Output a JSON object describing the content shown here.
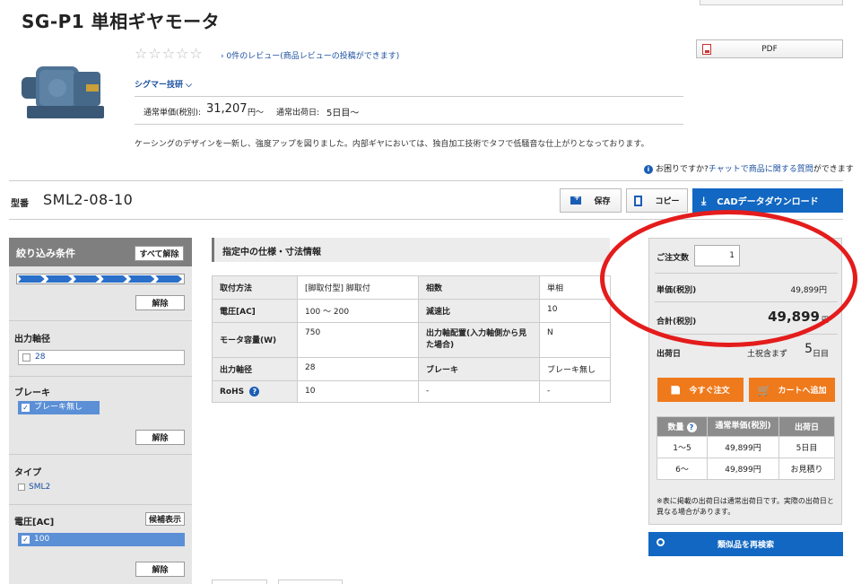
{
  "product": {
    "title": "SG-P1 単相ギヤモータ",
    "stars": "☆☆☆☆☆",
    "review_link": "0件のレビュー(商品レビューの投稿ができます)",
    "maker": "シグマー技研",
    "price_label": "通常単価(税別):",
    "price_value": "31,207",
    "price_suffix": "円〜",
    "ship_label": "通常出荷日:",
    "ship_value": "5日目〜",
    "description": "ケーシングのデザインを一新し、強度アップを図りました。内部ギヤにおいては、独自加工技術でタフで低騒音な仕上がりとなっております。"
  },
  "toolbar": {
    "pdf_label": "PDF",
    "save_label": "保存",
    "copy_label": "コピー",
    "cad_label": "CADデータダウンロード"
  },
  "help": {
    "prefix": "お困りですか?",
    "link": "チャットで商品に関する質問",
    "suffix": "ができます"
  },
  "model": {
    "label": "型番",
    "value": "SML2-08-10"
  },
  "sidebar": {
    "title": "絞り込み条件",
    "clear_all": "すべて解除",
    "clear": "解除",
    "output_shaft_label": "出力軸径",
    "output_shaft_option": "28",
    "brake_label": "ブレーキ",
    "brake_option": "ブレーキ無し",
    "type_label": "タイプ",
    "type_option": "SML2",
    "voltage_label": "電圧[AC]",
    "candidates": "候補表示",
    "voltage_option": "100"
  },
  "spec": {
    "title": "指定中の仕様・寸法情報",
    "rows": [
      [
        "取付方法",
        "[脚取付型] 脚取付",
        "相数",
        "単相"
      ],
      [
        "電圧[AC]",
        "100 〜 200",
        "減速比",
        "10"
      ],
      [
        "モータ容量(W)",
        "750",
        "出力軸配置(入力軸側から見た場合)",
        "N"
      ],
      [
        "出力軸径",
        "28",
        "ブレーキ",
        "ブレーキ無し"
      ],
      [
        "RoHS",
        "10",
        "-",
        "-"
      ]
    ]
  },
  "order": {
    "qty_label": "ご注文数",
    "qty_value": "1",
    "unit_label": "単価(税別)",
    "unit_price": "49,899円",
    "total_label": "合計(税別)",
    "total_price": "49,899",
    "total_unit": "円",
    "ship_label": "出荷日",
    "ship_text": "土祝含まず",
    "ship_days": "5",
    "ship_unit": "日目",
    "order_now": "今すぐ注文",
    "add_cart": "カートへ追加",
    "table_headers": [
      "数量",
      "通常単価(税別)",
      "出荷日"
    ],
    "table_rows": [
      [
        "1〜5",
        "49,899円",
        "5日目"
      ],
      [
        "6〜",
        "49,899円",
        "お見積り"
      ]
    ],
    "note": "※表に掲載の出荷日は通常出荷日です。実際の出荷日と異なる場合があります。",
    "research": "類似品を再検索"
  },
  "colors": {
    "accent_blue": "#1167c2",
    "order_orange": "#ef7a1c",
    "highlight_red": "#e41c1c"
  }
}
